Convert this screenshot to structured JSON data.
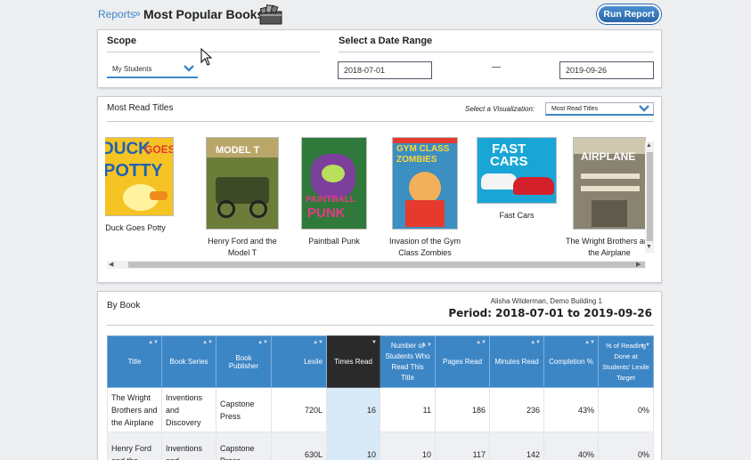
{
  "header": {
    "breadcrumb": "Reports",
    "separator": "»",
    "title": "Most Popular Books",
    "run_button": "Run Report"
  },
  "scope": {
    "label": "Scope",
    "selected": "My Students"
  },
  "date_range": {
    "label": "Select a Date Range",
    "start": "2018-07-01",
    "separator": "—",
    "end": "2019-09-26"
  },
  "most_read": {
    "title": "Most Read Titles",
    "viz_label": "Select a Visualization:",
    "viz_selected": "Most Read Titles",
    "books": [
      {
        "title": "Duck Goes Potty",
        "cover_color": "#f6c324"
      },
      {
        "title": "Henry Ford and the Model T",
        "cover_color": "#6c7d3a"
      },
      {
        "title": "Paintball Punk",
        "cover_color": "#2f7a3a"
      },
      {
        "title": "Invasion of the Gym Class Zombies",
        "cover_color": "#3b8fc1"
      },
      {
        "title": "Fast Cars",
        "cover_color": "#19a6d6"
      },
      {
        "title": "The Wright Brothers and the Airplane",
        "cover_color": "#8a8372"
      }
    ]
  },
  "by_book": {
    "title": "By Book",
    "teacher": "Alisha Wilderman, Demo Building 1",
    "period": "Period: 2018-07-01 to 2019-09-26",
    "columns": [
      "Title",
      "Book Series",
      "Book Publisher",
      "Lexile",
      "Times Read",
      "Number of Students Who Read This Title",
      "Pages Read",
      "Minutes Read",
      "Completion %",
      "% of Reading Done at Students' Lexile Target"
    ],
    "rows": [
      {
        "title": "The Wright Brothers and the Airplane",
        "series": "Inventions and Discovery",
        "publisher": "Capstone Press",
        "lexile": "720L",
        "times_read": "16",
        "students": "11",
        "pages": "186",
        "minutes": "236",
        "completion": "43%",
        "target": "0%"
      },
      {
        "title": "Henry Ford and the",
        "series": "Inventions and",
        "publisher": "Capstone Press",
        "lexile": "630L",
        "times_read": "10",
        "students": "10",
        "pages": "117",
        "minutes": "142",
        "completion": "40%",
        "target": "0%"
      }
    ]
  },
  "colors": {
    "accent": "#3d86c6",
    "sorted_header": "#2a2a2a"
  }
}
